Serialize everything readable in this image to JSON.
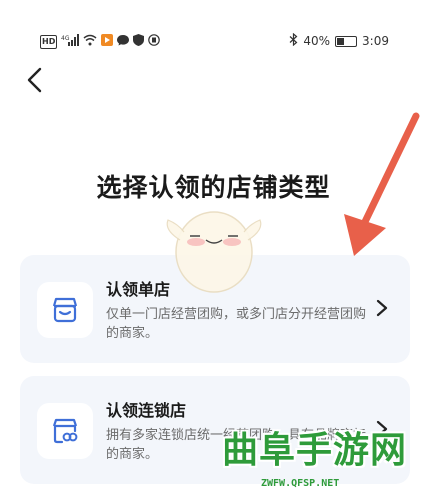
{
  "status_bar": {
    "left_icons": [
      "hd-icon",
      "signal-4g-icon",
      "wifi-icon",
      "app-notification-icon",
      "chat-icon",
      "shield-icon",
      "app-icon"
    ],
    "hd_label": "HD",
    "network_label": "4G",
    "bluetooth_icon": "bluetooth-icon",
    "battery_percent": "40%",
    "battery_level": 0.4,
    "time": "3:09"
  },
  "header": {
    "back_icon": "chevron-left-icon"
  },
  "main": {
    "title": "选择认领的店铺类型",
    "cards": [
      {
        "icon": "storefront-icon",
        "title": "认领单店",
        "description": "仅单一门店经营团购，或多门店分开经营团购的商家。"
      },
      {
        "icon": "chain-store-icon",
        "title": "认领连锁店",
        "description": "拥有多家连锁店统一经营团购，具有品牌商标的商家。"
      }
    ]
  },
  "overlay": {
    "watermark_text": "曲阜手游网",
    "watermark_url": "ZWFW.QFSP.NET",
    "arrow_color": "#e8604a",
    "watermark_color": "#2e9b3a"
  }
}
